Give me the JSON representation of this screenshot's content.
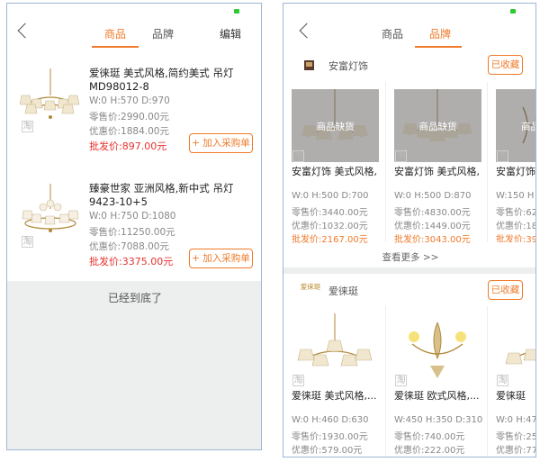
{
  "left": {
    "tabs": [
      "商品",
      "品牌"
    ],
    "edit_label": "编辑",
    "watermark": "淘",
    "products": [
      {
        "name": "爱徕珽 美式风格,简约美式 吊灯 MD98012-8",
        "spec": "W:0 H:570 D:970",
        "retail": "零售价:2990.00元",
        "discount": "优惠价:1884.00元",
        "wholesale": "批发价:897.00元",
        "add_label": "+ 加入采购单"
      },
      {
        "name": "臻豪世家 亚洲风格,新中式 吊灯 9423-10+5",
        "spec": "W:0 H:750 D:1080",
        "retail": "零售价:11250.00元",
        "discount": "优惠价:7088.00元",
        "wholesale": "批发价:3375.00元",
        "add_label": "+ 加入采购单"
      }
    ],
    "bottom_text": "已经到底了"
  },
  "right": {
    "tabs": [
      "商品",
      "品牌"
    ],
    "watermark": "淘",
    "out_of_stock": "商品缺货",
    "see_more": "查看更多 >>",
    "brands": [
      {
        "name": "安富灯饰",
        "fav_label": "已收藏",
        "cards": [
          {
            "name": "安富灯饰 美式风格,",
            "spec": "W:0 H:500 D:700",
            "retail": "零售价:3440.00元",
            "discount": "优惠价:1032.00元",
            "wholesale": "批发价:2167.00元"
          },
          {
            "name": "安富灯饰 美式风格,",
            "spec": "W:0 H:500 D:870",
            "retail": "零售价:4830.00元",
            "discount": "优惠价:1449.00元",
            "wholesale": "批发价:3043.00元"
          },
          {
            "name": "安富灯饰",
            "spec": "W:150 H",
            "retail": "零售价:62",
            "discount": "优惠价:18",
            "wholesale": "批发价:39"
          }
        ]
      },
      {
        "name": "爱徕珽",
        "logo_text": "爱徕珽",
        "fav_label": "已收藏",
        "cards": [
          {
            "name": "爱徕珽 美式风格,...",
            "spec": "W:0 H:460 D:630",
            "retail": "零售价:1930.00元",
            "discount": "优惠价:579.00元"
          },
          {
            "name": "爱徕珽 欧式风格,...",
            "spec": "W:450 H:350 D:310",
            "retail": "零售价:740.00元",
            "discount": "优惠价:222.00元"
          },
          {
            "name": "爱徕珽",
            "spec": "W:0 H:470",
            "retail": "零售价:25",
            "discount": "优惠价:77"
          }
        ]
      }
    ]
  },
  "colors": {
    "accent": "#ef7a2a",
    "price_red": "#e5322d",
    "status_green": "#2ec92e",
    "frame_border": "#9fb6d6"
  }
}
